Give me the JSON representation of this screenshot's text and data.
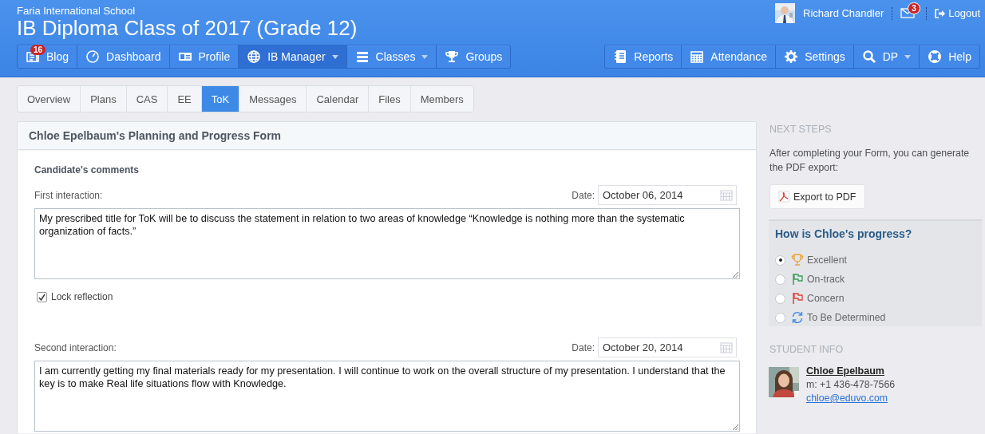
{
  "header": {
    "school": "Faria International School",
    "title": "IB Diploma Class of 2017 (Grade 12)",
    "user": {
      "name": "Richard Chandler",
      "message_count": "3",
      "logout": "Logout"
    },
    "nav_left": [
      {
        "label": "Blog",
        "kind": "blog",
        "badge": "16",
        "selected": false,
        "dropdown": false
      },
      {
        "label": "Dashboard",
        "kind": "dashboard",
        "selected": false,
        "dropdown": false
      },
      {
        "label": "Profile",
        "kind": "profile",
        "selected": false,
        "dropdown": false
      },
      {
        "label": "IB Manager",
        "kind": "globe",
        "selected": true,
        "dropdown": true
      },
      {
        "label": "Classes",
        "kind": "classes",
        "selected": false,
        "dropdown": true
      },
      {
        "label": "Groups",
        "kind": "trophy",
        "selected": false,
        "dropdown": false
      }
    ],
    "nav_right": [
      {
        "label": "Reports",
        "kind": "reports",
        "selected": false,
        "dropdown": false
      },
      {
        "label": "Attendance",
        "kind": "calendar",
        "selected": false,
        "dropdown": false
      },
      {
        "label": "Settings",
        "kind": "gear",
        "selected": false,
        "dropdown": false
      },
      {
        "label": "DP",
        "kind": "search",
        "selected": false,
        "dropdown": true
      },
      {
        "label": "Help",
        "kind": "lifering",
        "selected": false,
        "dropdown": false
      }
    ]
  },
  "tabs": [
    {
      "label": "Overview",
      "selected": false
    },
    {
      "label": "Plans",
      "selected": false
    },
    {
      "label": "CAS",
      "selected": false
    },
    {
      "label": "EE",
      "selected": false
    },
    {
      "label": "ToK",
      "selected": true
    },
    {
      "label": "Messages",
      "selected": false
    },
    {
      "label": "Calendar",
      "selected": false
    },
    {
      "label": "Files",
      "selected": false
    },
    {
      "label": "Members",
      "selected": false
    }
  ],
  "form": {
    "title": "Chloe Epelbaum's Planning and Progress Form",
    "section": "Candidate's comments",
    "interactions": [
      {
        "label": "First interaction:",
        "date_label": "Date:",
        "date": "October 06, 2014",
        "text": "My prescribed title for ToK will be to discuss the statement in relation to two areas of knowledge “Knowledge is nothing more than the systematic organization of facts.”",
        "lock": {
          "label": "Lock reflection",
          "checked": true
        }
      },
      {
        "label": "Second interaction:",
        "date_label": "Date:",
        "date": "October 20, 2014",
        "text": "I am currently getting my final materials ready for my presentation. I will continue to work on the overall structure of  my presentation. I understand that the key is to make Real life situations flow with Knowledge."
      }
    ]
  },
  "sidebar": {
    "next_steps": {
      "heading": "NEXT STEPS",
      "text": "After completing your Form, you can generate the PDF export:",
      "button": "Export to PDF"
    },
    "progress": {
      "title": "How is Chloe's progress?",
      "options": [
        {
          "label": "Excellent",
          "kind": "trophy",
          "selected": true
        },
        {
          "label": "On-track",
          "kind": "green-flag",
          "selected": false
        },
        {
          "label": "Concern",
          "kind": "red-flag",
          "selected": false
        },
        {
          "label": "To Be Determined",
          "kind": "refresh",
          "selected": false
        }
      ]
    },
    "student": {
      "heading": "STUDENT INFO",
      "name": "Chloe Epelbaum",
      "phone": "m: +1 436-478-7566",
      "email": "chloe@eduvo.com"
    }
  }
}
